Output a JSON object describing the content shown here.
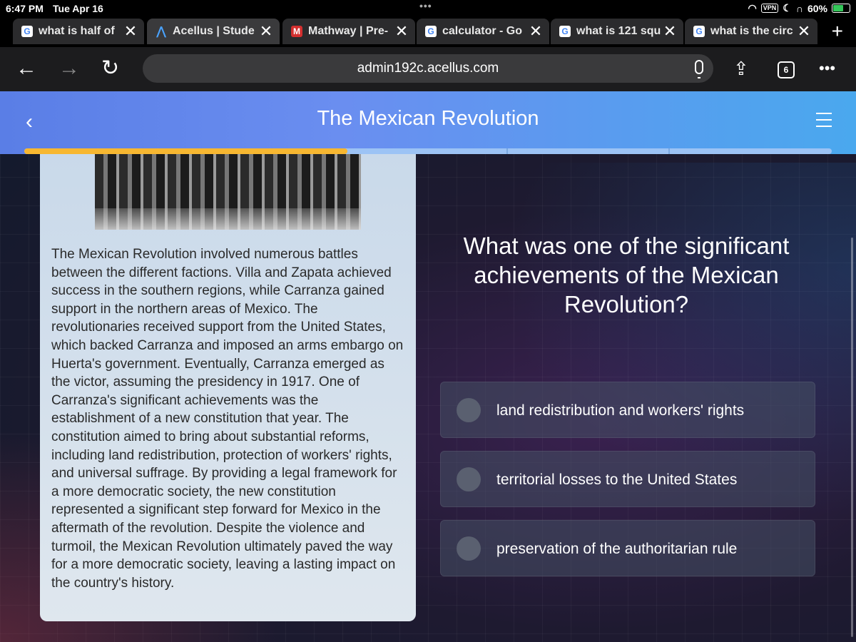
{
  "status_bar": {
    "time": "6:47 PM",
    "date": "Tue Apr 16",
    "vpn": "VPN",
    "battery": "60%"
  },
  "tabs": [
    {
      "title": "what is half of ",
      "favicon": "G"
    },
    {
      "title": "Acellus | Stude",
      "favicon": "A"
    },
    {
      "title": "Mathway | Pre-",
      "favicon": "M"
    },
    {
      "title": "calculator - Go",
      "favicon": "G"
    },
    {
      "title": "what is 121 squ",
      "favicon": "G"
    },
    {
      "title": "what is the circ",
      "favicon": "G"
    }
  ],
  "toolbar": {
    "url": "admin192c.acellus.com",
    "tab_count": "6"
  },
  "icons": {
    "back": "back-arrow-icon",
    "forward": "forward-arrow-icon",
    "reload": "reload-icon",
    "mic": "microphone-icon",
    "share": "share-icon",
    "tabs": "tab-count-icon",
    "more": "more-icon",
    "lesson_back": "chevron-left-icon",
    "menu": "hamburger-menu-icon"
  },
  "lesson": {
    "title": "The Mexican Revolution",
    "progress": 0.4,
    "passage": "The Mexican Revolution involved numerous battles between the different factions. Villa and Zapata achieved success in the southern regions, while Carranza gained support in the northern areas of Mexico. The revolutionaries received support from the United States, which backed Carranza and imposed an arms embargo on Huerta's government. Eventually, Carranza emerged as the victor, assuming the presidency in 1917. One of Carranza's significant achievements was the establishment of a new constitution that year. The constitution aimed to bring about substantial reforms, including land redistribution, protection of workers' rights, and universal suffrage. By providing a legal framework for a more democratic society, the new constitution represented a significant step forward for Mexico in the aftermath of the revolution. Despite the violence and turmoil, the Mexican Revolution ultimately paved the way for a more democratic society, leaving a lasting impact on the country's history."
  },
  "question": {
    "text": "What was one of the significant achievements of the Mexican Revolution?",
    "options": [
      "land redistribution and workers' rights",
      "territorial losses to the United States",
      "preservation of the authoritarian rule"
    ]
  },
  "colors": {
    "accent": "#5a7ee6",
    "progress": "#f7b731"
  }
}
